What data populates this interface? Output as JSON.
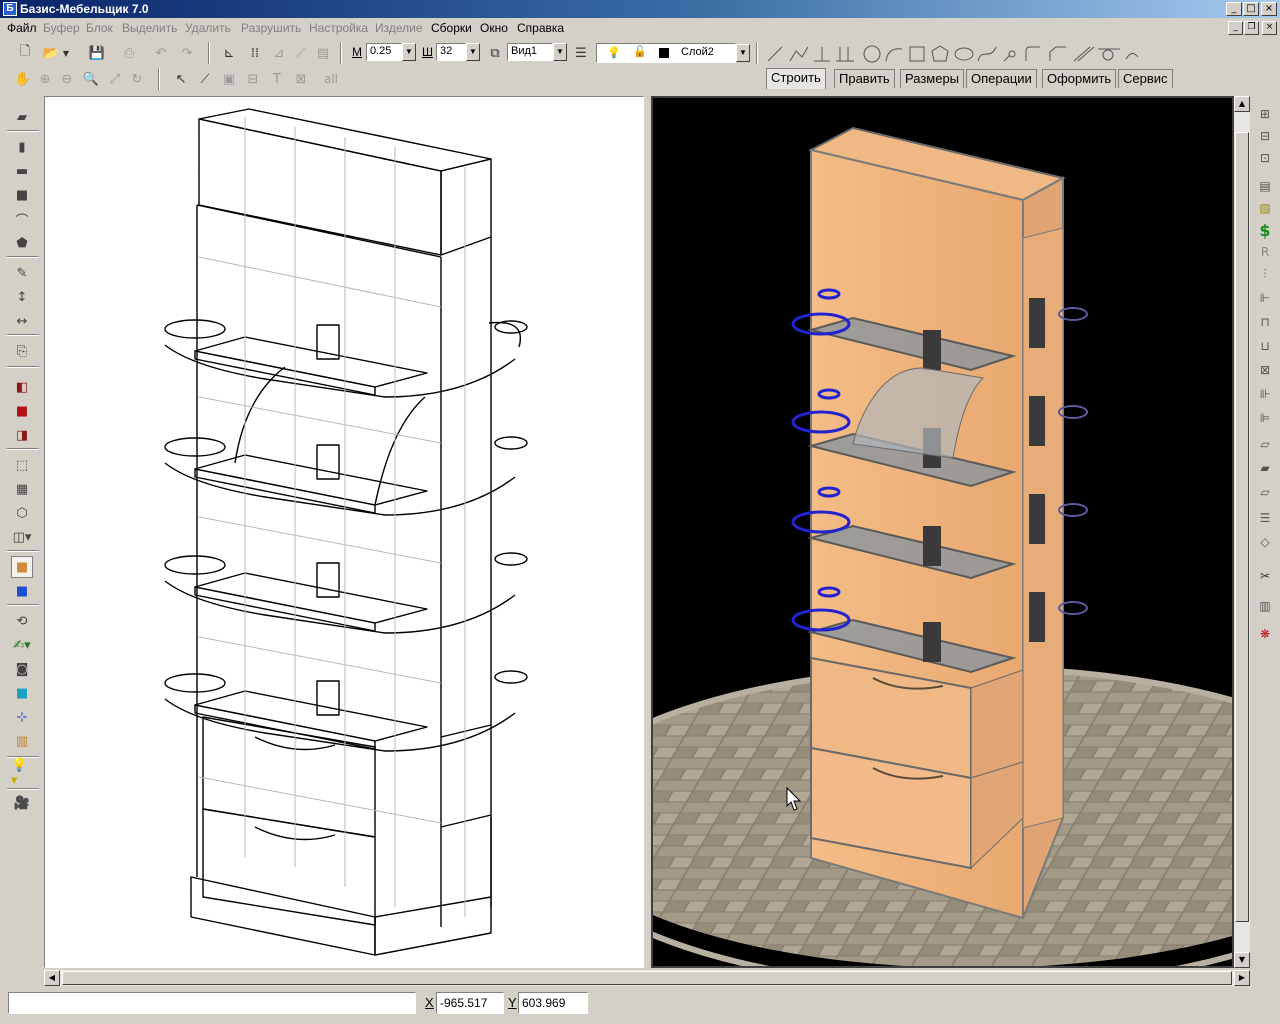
{
  "window": {
    "title": "Базис-Мебельщик 7.0",
    "app_icon": "Б"
  },
  "window_buttons": {
    "minimize": "_",
    "maximize": "□",
    "close": "×"
  },
  "mdi_buttons": {
    "minimize": "_",
    "restore": "❐",
    "close": "×"
  },
  "menu": [
    {
      "label": "Файл",
      "enabled": true
    },
    {
      "label": "Буфер",
      "enabled": false
    },
    {
      "label": "Блок",
      "enabled": false
    },
    {
      "label": "Выделить",
      "enabled": false
    },
    {
      "label": "Удалить",
      "enabled": false
    },
    {
      "label": "Разрушить",
      "enabled": false
    },
    {
      "label": "Настройка",
      "enabled": false
    },
    {
      "label": "Изделие",
      "enabled": false
    },
    {
      "label": "Сборки",
      "enabled": true
    },
    {
      "label": "Окно",
      "enabled": true
    },
    {
      "label": "Справка",
      "enabled": true
    }
  ],
  "toolbar": {
    "m_label": "М",
    "m_value": "0.25",
    "sh_label": "Ш",
    "sh_value": "32",
    "view_value": "Вид1",
    "layer_value": "Слой2",
    "all_label": "all"
  },
  "tabs": [
    {
      "label": "Строить",
      "active": true
    },
    {
      "label": "Править",
      "active": false
    },
    {
      "label": "Размеры",
      "active": false
    },
    {
      "label": "Операции",
      "active": false
    },
    {
      "label": "Оформить",
      "active": false
    },
    {
      "label": "Сервис",
      "active": false
    }
  ],
  "right_toolbar": {
    "dollar_glyph": "$",
    "r_glyph": "R"
  },
  "status": {
    "command_text": "",
    "x_label": "X",
    "x_value": "-965.517",
    "y_label": "Y",
    "y_value": "603.969"
  },
  "colors": {
    "title_start": "#0a246a",
    "title_end": "#a6caf0",
    "face": "#d4d0c8",
    "wood": "#f0b57e",
    "shelf_glass": "#9aa3a8",
    "ring_blue": "#2a2ad8"
  }
}
